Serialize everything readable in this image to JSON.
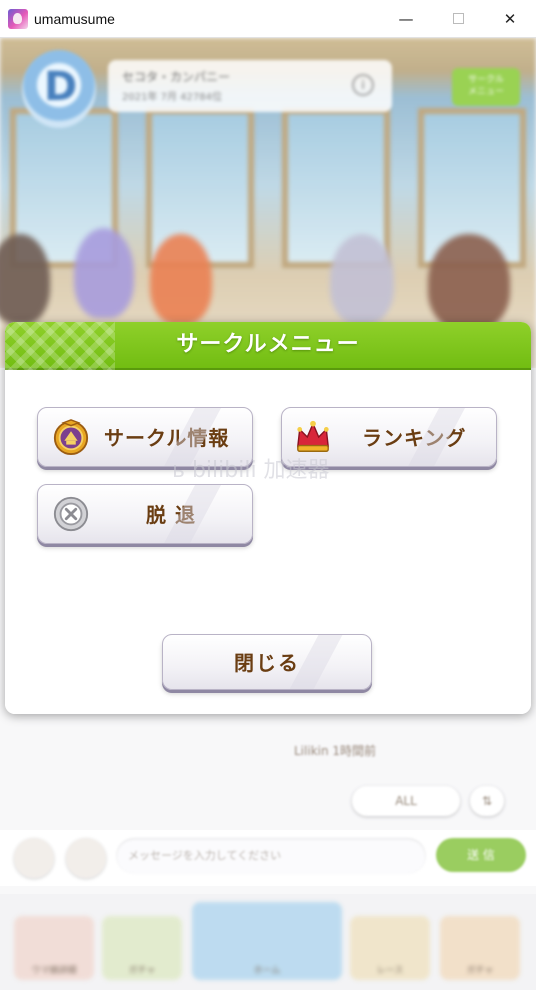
{
  "window": {
    "title": "umamusume",
    "minimize_glyph": "—",
    "close_glyph": "✕"
  },
  "background": {
    "circle_name": "セコタ・カンパニー",
    "circle_sub": "2021年 7月 42784位",
    "info_glyph": "i",
    "green_tag_text": "サークル\nメニュー",
    "member_name": "Lilikin 1時間前",
    "filter_all": "ALL",
    "sort_glyph": "⇅",
    "chat_placeholder": "メッセージを入力してください",
    "send_label": "送 信",
    "nav_labels": [
      "ウマ娘詳細",
      "ガチャ",
      "ホーム",
      "レース",
      "ガチャ"
    ]
  },
  "dialog": {
    "title": "サークルメニュー",
    "buttons": {
      "circle_info": "サークル情報",
      "ranking": "ランキング",
      "leave": "脱 退"
    },
    "close_label": "閉じる"
  },
  "overlay": {
    "watermark": "ь bilibili 加速器"
  },
  "colors": {
    "header_green": "#7cc61a",
    "button_text": "#6a3d12",
    "button_border": "#8f88a3"
  },
  "icons": {
    "circle_info": "circle-emblem-icon",
    "ranking": "crown-icon",
    "leave": "cancel-circle-icon"
  }
}
